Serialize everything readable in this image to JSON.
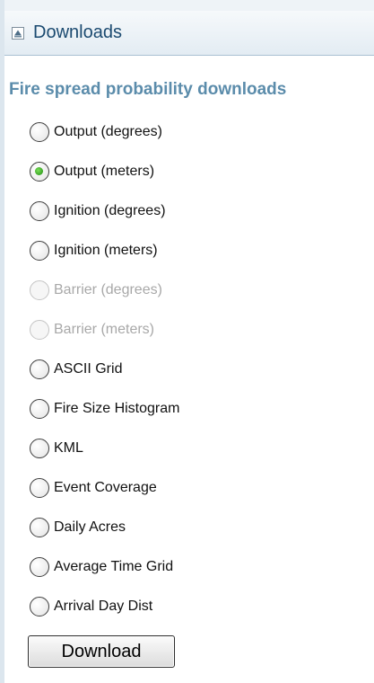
{
  "panel": {
    "title": "Downloads",
    "collapse_icon": "collapse-up-icon"
  },
  "section": {
    "title": "Fire spread probability downloads"
  },
  "options": [
    {
      "label": "Output (degrees)",
      "checked": false,
      "disabled": false
    },
    {
      "label": "Output (meters)",
      "checked": true,
      "disabled": false
    },
    {
      "label": "Ignition (degrees)",
      "checked": false,
      "disabled": false
    },
    {
      "label": "Ignition (meters)",
      "checked": false,
      "disabled": false
    },
    {
      "label": "Barrier (degrees)",
      "checked": false,
      "disabled": true
    },
    {
      "label": "Barrier (meters)",
      "checked": false,
      "disabled": true
    },
    {
      "label": "ASCII Grid",
      "checked": false,
      "disabled": false
    },
    {
      "label": "Fire Size Histogram",
      "checked": false,
      "disabled": false
    },
    {
      "label": "KML",
      "checked": false,
      "disabled": false
    },
    {
      "label": "Event Coverage",
      "checked": false,
      "disabled": false
    },
    {
      "label": "Daily Acres",
      "checked": false,
      "disabled": false
    },
    {
      "label": "Average Time Grid",
      "checked": false,
      "disabled": false
    },
    {
      "label": "Arrival Day Dist",
      "checked": false,
      "disabled": false
    }
  ],
  "download_button": {
    "label": "Download"
  },
  "colors": {
    "header_text": "#1b4a70",
    "section_title": "#5b8cab",
    "radio_selected": "#2f9a1c",
    "disabled_text": "#a8a8a8"
  }
}
